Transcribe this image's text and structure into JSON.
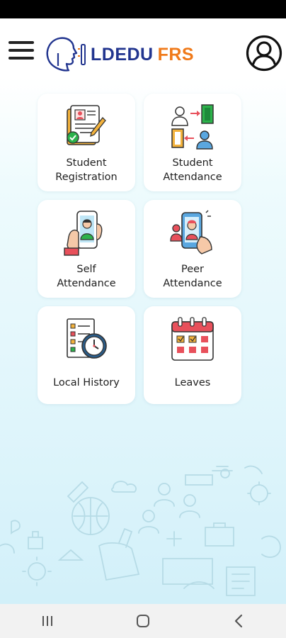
{
  "header": {
    "logo_primary": "LDEDU",
    "logo_secondary": "FRS"
  },
  "tiles": [
    {
      "label": "Student\nRegistration",
      "icon": "registration-document-icon"
    },
    {
      "label": "Student\nAttendance",
      "icon": "student-attendance-icon"
    },
    {
      "label": "Self\nAttendance",
      "icon": "self-attendance-phone-icon"
    },
    {
      "label": "Peer\nAttendance",
      "icon": "peer-attendance-phone-icon"
    },
    {
      "label": "Local History",
      "icon": "local-history-clock-icon"
    },
    {
      "label": "Leaves",
      "icon": "calendar-leaves-icon"
    }
  ],
  "colors": {
    "brand_blue": "#22358f",
    "brand_orange": "#f07a1a",
    "accent_red": "#e8505b",
    "background_tint": "#dff5fb"
  },
  "nav": {
    "recents": "recents-icon",
    "home": "home-icon",
    "back": "back-icon"
  }
}
